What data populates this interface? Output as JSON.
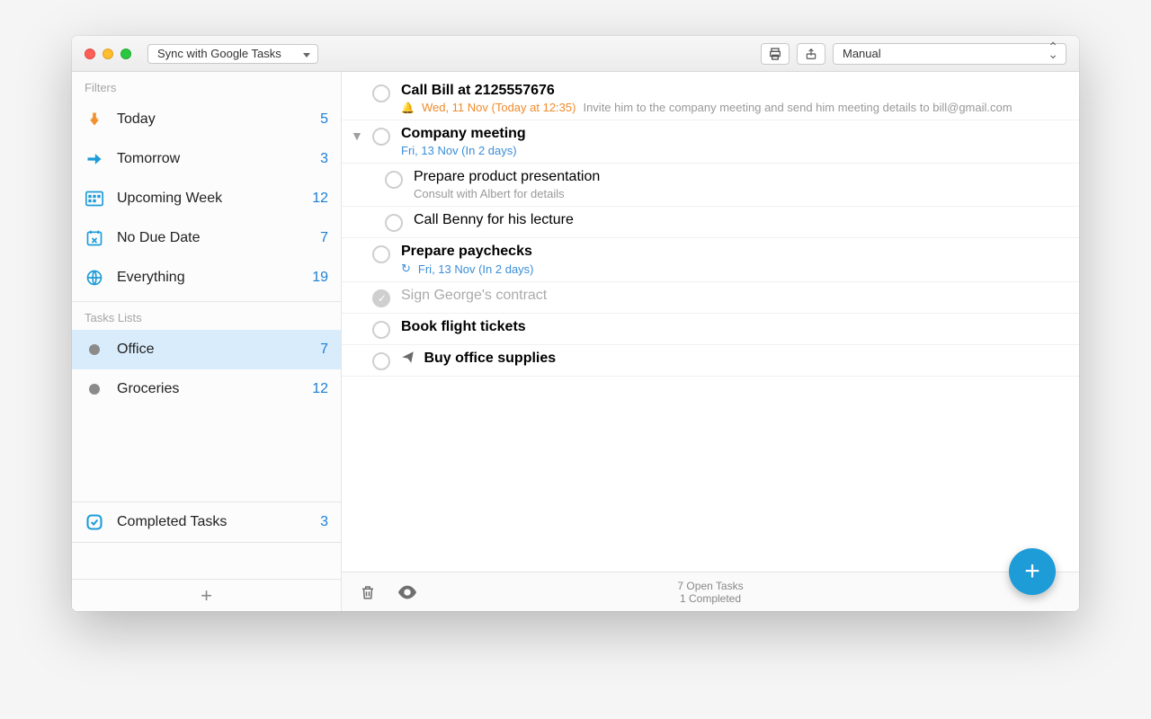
{
  "titlebar": {
    "sync_label": "Sync with Google Tasks",
    "sort_label": "Manual"
  },
  "sidebar": {
    "filters_label": "Filters",
    "filters": [
      {
        "label": "Today",
        "count": 5
      },
      {
        "label": "Tomorrow",
        "count": 3
      },
      {
        "label": "Upcoming Week",
        "count": 12
      },
      {
        "label": "No Due Date",
        "count": 7
      },
      {
        "label": "Everything",
        "count": 19
      }
    ],
    "lists_label": "Tasks Lists",
    "lists": [
      {
        "label": "Office",
        "count": 7
      },
      {
        "label": "Groceries",
        "count": 12
      }
    ],
    "completed": {
      "label": "Completed Tasks",
      "count": 3
    }
  },
  "tasks": {
    "items": [
      {
        "title": "Call Bill at 2125557676",
        "date": "Wed, 11 Nov (Today at 12:35)",
        "date_color": "orange",
        "alarm": true,
        "note": "Invite him to the company meeting and send him meeting details to bill@gmail.com"
      },
      {
        "title": "Company meeting",
        "date": "Fri, 13 Nov (In 2 days)",
        "date_color": "blue",
        "expanded": true,
        "children": [
          {
            "title": "Prepare product presentation",
            "note": "Consult with Albert for details"
          },
          {
            "title": "Call Benny for his lecture"
          }
        ]
      },
      {
        "title": "Prepare paychecks",
        "date": "Fri, 13 Nov (In 2 days)",
        "date_color": "blue",
        "repeat": true
      },
      {
        "title": "Sign George's contract",
        "completed": true
      },
      {
        "title": "Book flight tickets"
      },
      {
        "title": "Buy office supplies",
        "sent": true
      }
    ]
  },
  "footer": {
    "open": "7 Open Tasks",
    "completed": "1 Completed"
  }
}
